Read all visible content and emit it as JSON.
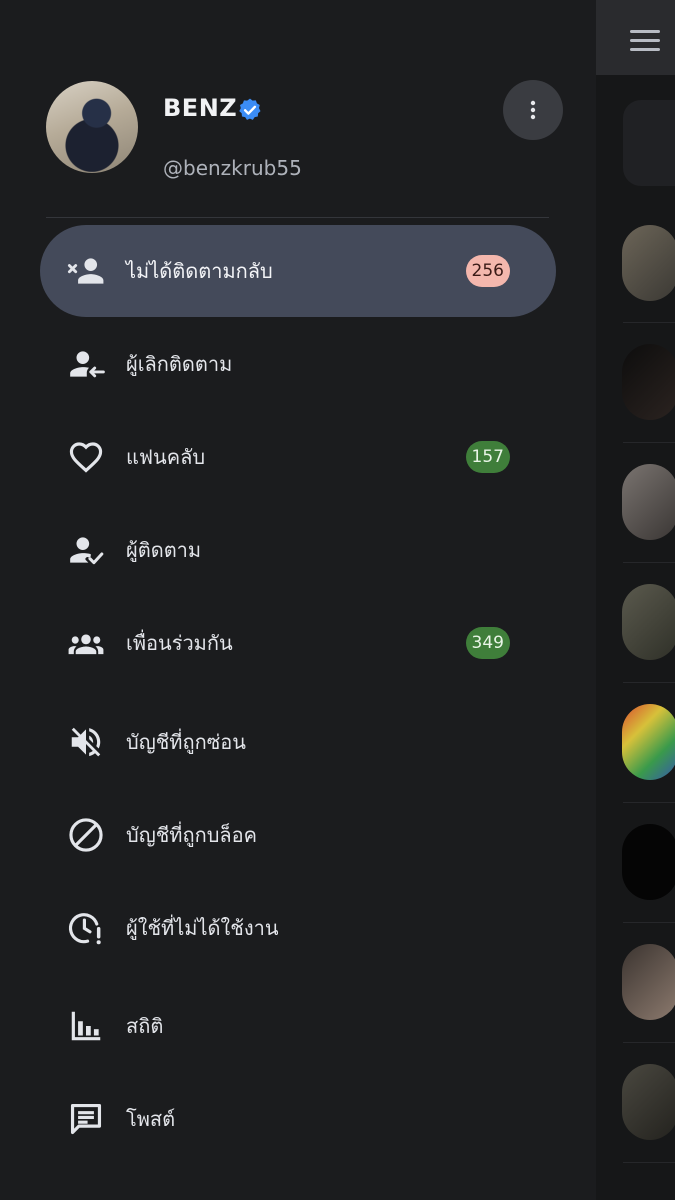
{
  "profile": {
    "name": "BENZ",
    "handle": "@benzkrub55",
    "verified_color": "#3b8cf5"
  },
  "menu": [
    {
      "id": "not-following-back",
      "label": "ไม่ได้ติดตามกลับ",
      "icon": "person-remove-icon",
      "badge": "256",
      "badge_color": "#f4b7ad",
      "active": true
    },
    {
      "id": "unfollowers",
      "label": "ผู้เลิกติดตาม",
      "icon": "person-left-arrow-icon",
      "badge": null,
      "active": false
    },
    {
      "id": "fans",
      "label": "แฟนคลับ",
      "icon": "heart-icon",
      "badge": "157",
      "badge_color": "#3f7e3a",
      "active": false
    },
    {
      "id": "followers",
      "label": "ผู้ติดตาม",
      "icon": "person-check-icon",
      "badge": null,
      "active": false
    },
    {
      "id": "mutual-friends",
      "label": "เพื่อนร่วมกัน",
      "icon": "group-icon",
      "badge": "349",
      "badge_color": "#3f7e3a",
      "active": false
    },
    {
      "id": "muted-accounts",
      "label": "บัญชีที่ถูกซ่อน",
      "icon": "volume-off-icon",
      "badge": null,
      "active": false
    },
    {
      "id": "blocked-accounts",
      "label": "บัญชีที่ถูกบล็อค",
      "icon": "block-icon",
      "badge": null,
      "active": false
    },
    {
      "id": "inactive-users",
      "label": "ผู้ใช้ที่ไม่ได้ใช้งาน",
      "icon": "clock-alert-icon",
      "badge": null,
      "active": false
    },
    {
      "id": "statistics",
      "label": "สถิติ",
      "icon": "bar-chart-icon",
      "badge": null,
      "active": false
    },
    {
      "id": "posts",
      "label": "โพสต์",
      "icon": "message-icon",
      "badge": null,
      "active": false
    }
  ],
  "colors": {
    "drawer_bg": "#1b1c1e",
    "active_bg": "#444a5a",
    "icon": "#e3e5ea"
  }
}
